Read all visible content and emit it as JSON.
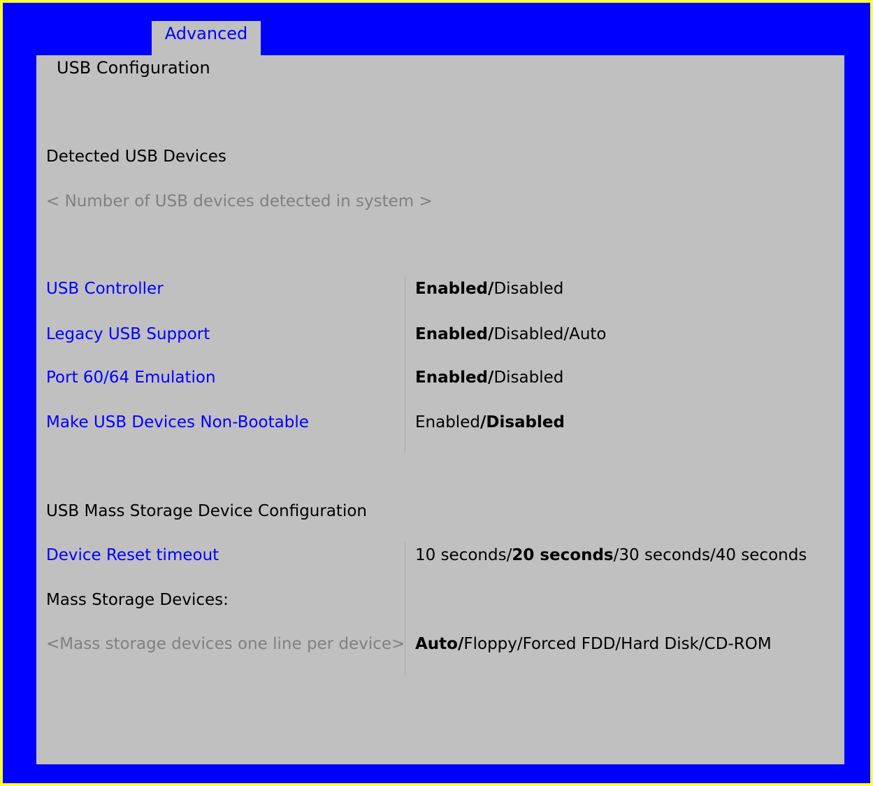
{
  "tabs": [
    {
      "label": "Advanced"
    }
  ],
  "page_title": "USB Configuration",
  "sections": {
    "detected": {
      "heading": "Detected USB Devices",
      "info": "< Number of USB devices detected in system >"
    },
    "mass_storage": {
      "heading": "USB Mass Storage Device Configuration"
    }
  },
  "settings": [
    {
      "label": "USB Controller",
      "options": [
        {
          "text": "Enabled",
          "bold": true
        },
        {
          "text": "/",
          "bold": true
        },
        {
          "text": "Disabled",
          "bold": false
        }
      ]
    },
    {
      "label": "Legacy USB Support",
      "options": [
        {
          "text": "Enabled",
          "bold": true
        },
        {
          "text": "/",
          "bold": true
        },
        {
          "text": "Disabled/Auto",
          "bold": false
        }
      ]
    },
    {
      "label": "Port 60/64 Emulation",
      "options": [
        {
          "text": "Enabled",
          "bold": true
        },
        {
          "text": "/",
          "bold": true
        },
        {
          "text": "Disabled",
          "bold": false
        }
      ]
    },
    {
      "label": "Make USB Devices Non-Bootable",
      "options": [
        {
          "text": "Enabled",
          "bold": false
        },
        {
          "text": "/Disabled",
          "bold": true
        }
      ]
    },
    {
      "label": "Device Reset timeout",
      "options": [
        {
          "text": "10 seconds/",
          "bold": false
        },
        {
          "text": "20 seconds",
          "bold": true
        },
        {
          "text": "/30 seconds/40 seconds",
          "bold": false
        }
      ]
    }
  ],
  "mass_storage_label": "Mass Storage Devices:",
  "mass_storage_device": {
    "label": "<Mass storage devices one line per device>",
    "options": [
      {
        "text": "Auto/",
        "bold": true
      },
      {
        "text": "Floppy/Forced FDD/Hard Disk/CD-ROM",
        "bold": false
      }
    ]
  }
}
